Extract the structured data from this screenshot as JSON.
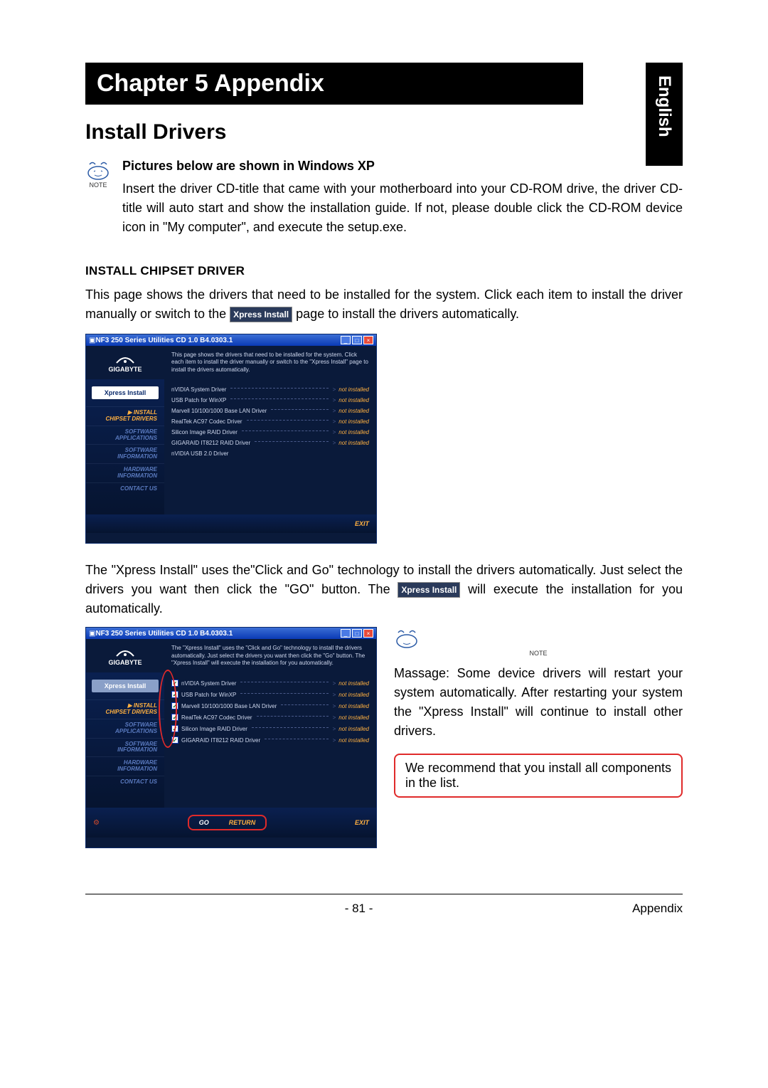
{
  "lang_tab": "English",
  "chapter_bar": "Chapter 5  Appendix",
  "section_title": "Install Drivers",
  "note_label": "NOTE",
  "note_subtitle": "Pictures below are shown in Windows XP",
  "note_body": "Insert the driver CD-title that came with your motherboard into your CD-ROM drive, the driver CD-title will auto start and show the installation guide. If not, please double click the CD-ROM device icon in \"My computer\", and execute the setup.exe.",
  "subsection_title": "INSTALL CHIPSET DRIVER",
  "para1_a": "This page shows the drivers that need to be installed for the system. Click each item to install the driver manually or switch to the ",
  "para1_b": " page to install the drivers automatically.",
  "badge_label": "Xpress Install",
  "para2_a": "The \"Xpress Install\" uses the\"Click and Go\" technology to install the drivers automatically. Just select the drivers you want then click the \"GO\" button. The ",
  "para2_b": " will execute the installation for you automatically.",
  "side_note_text": "Massage: Some device drivers will restart your system automatically. After restarting your system the \"Xpress Install\" will continue to install other drivers.",
  "callout_text": "We recommend that you install all components in the list.",
  "footer_left": "- 81 -",
  "footer_right": "Appendix",
  "app": {
    "title": "NF3 250 Series Utilities CD 1.0 B4.0303.1",
    "logo": "GIGABYTE",
    "desc1": "This page shows the drivers that need to be installed for the system. Click each item to install the driver manually or switch to the \"Xpress Install\" page to install the drivers automatically.",
    "desc2": "The \"Xpress Install\" uses the \"Click and Go\" technology to install the drivers automatically. Just select the drivers you want then click the \"Go\" button. The \"Xpress Install\" will execute the installation for you automatically.",
    "xpress_badge": "Xpress Install",
    "sidebar": [
      {
        "label": "▶ INSTALL\nCHIPSET DRIVERS",
        "active": true,
        "has_arrow": true
      },
      {
        "label": "SOFTWARE\nAPPLICATIONS",
        "active": false
      },
      {
        "label": "SOFTWARE\nINFORMATION",
        "active": false
      },
      {
        "label": "HARDWARE\nINFORMATION",
        "active": false
      },
      {
        "label": "CONTACT US",
        "active": false
      }
    ],
    "drivers1": [
      {
        "name": "nVIDIA System Driver",
        "status": "not installed"
      },
      {
        "name": "USB Patch for WinXP",
        "status": "not installed"
      },
      {
        "name": "Marvell 10/100/1000 Base LAN Driver",
        "status": "not installed"
      },
      {
        "name": "RealTek AC97 Codec Driver",
        "status": "not installed"
      },
      {
        "name": "Silicon Image RAID Driver",
        "status": "not installed"
      },
      {
        "name": "GIGARAID IT8212 RAID Driver",
        "status": "not installed"
      },
      {
        "name": "nVIDIA USB 2.0 Driver",
        "status": ""
      }
    ],
    "drivers2": [
      {
        "name": "nVIDIA System Driver",
        "status": "not installed"
      },
      {
        "name": "USB Patch for WinXP",
        "status": "not installed"
      },
      {
        "name": "Marvell 10/100/1000 Base LAN Driver",
        "status": "not installed"
      },
      {
        "name": "RealTek AC97 Codec Driver",
        "status": "not installed"
      },
      {
        "name": "Silicon Image RAID Driver",
        "status": "not installed"
      },
      {
        "name": "GIGARAID IT8212 RAID Driver",
        "status": "not installed"
      }
    ],
    "footer": {
      "exit": "EXIT",
      "go": "GO",
      "return": "RETURN"
    }
  }
}
